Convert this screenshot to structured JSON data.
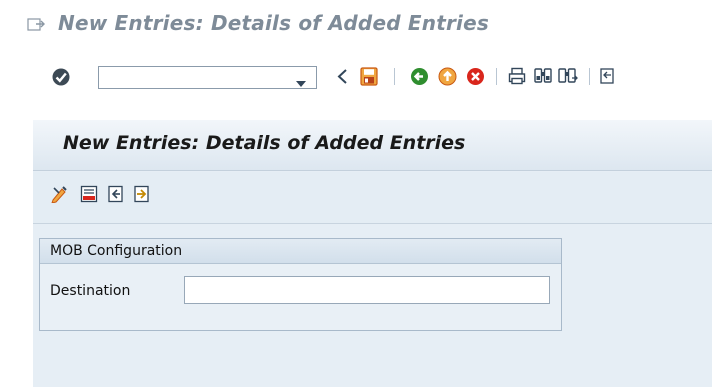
{
  "window": {
    "title": "New Entries: Details of Added Entries"
  },
  "system_toolbar": {
    "command_field_value": "",
    "icons": [
      "enter-icon",
      "command-dropdown-icon",
      "collapse-toolbar-icon",
      "save-icon",
      "back-icon",
      "exit-icon",
      "cancel-icon",
      "print-icon",
      "find-icon",
      "find-next-icon",
      "first-page-icon"
    ]
  },
  "screen": {
    "title": "New Entries: Details of Added Entries",
    "app_toolbar_icons": [
      "change-display-icon",
      "delete-icon",
      "previous-entry-icon",
      "next-entry-icon"
    ]
  },
  "group": {
    "title": "MOB Configuration",
    "fields": [
      {
        "label": "Destination",
        "value": ""
      }
    ]
  },
  "colors": {
    "title_text": "#7e8b98",
    "main_background": "#e6eef5",
    "group_border": "#a8b9ca"
  }
}
